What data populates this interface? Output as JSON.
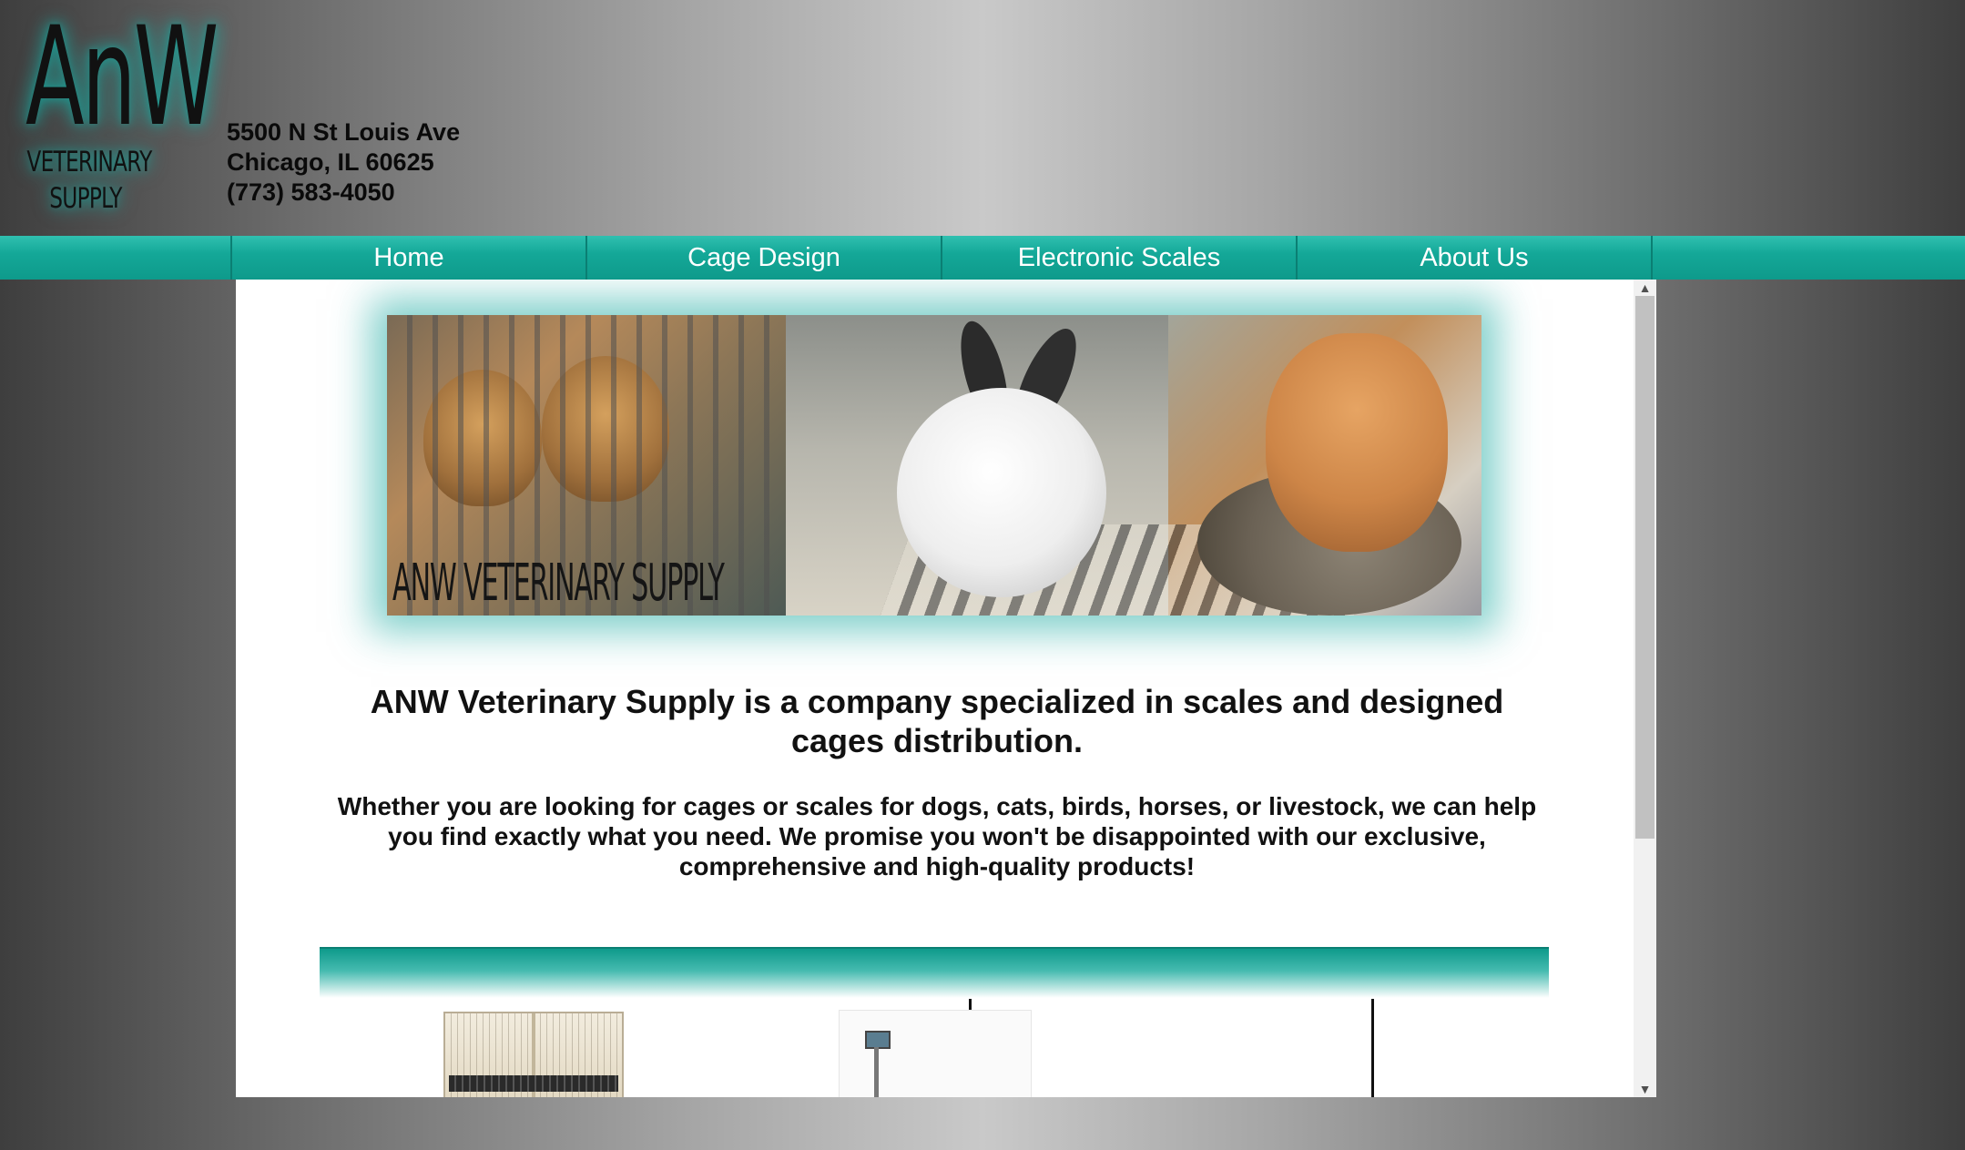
{
  "header": {
    "logo": {
      "main": "AnW",
      "line1": "VETERINARY",
      "line2": "SUPPLY"
    },
    "address": {
      "street": "5500 N St Louis Ave",
      "city": "Chicago, IL 60625",
      "phone": "(773) 583-4050"
    }
  },
  "nav": {
    "items": [
      "Home",
      "Cage Design",
      "Electronic Scales",
      "About Us"
    ]
  },
  "banner": {
    "text": "ANW VETERINARY SUPPLY"
  },
  "main": {
    "headline": "ANW Veterinary Supply is a company specialized in scales and designed cages distribution.",
    "intro": "Whether you are looking for cages or scales for dogs, cats, birds, horses, or livestock, we can help you find exactly what you need. We promise you won't be disappointed with our exclusive, comprehensive and high-quality products!"
  },
  "scrollbar": {
    "up_icon": "▲",
    "down_icon": "▼"
  },
  "colors": {
    "accent": "#14a898",
    "accent_dark": "#0b7f73"
  }
}
